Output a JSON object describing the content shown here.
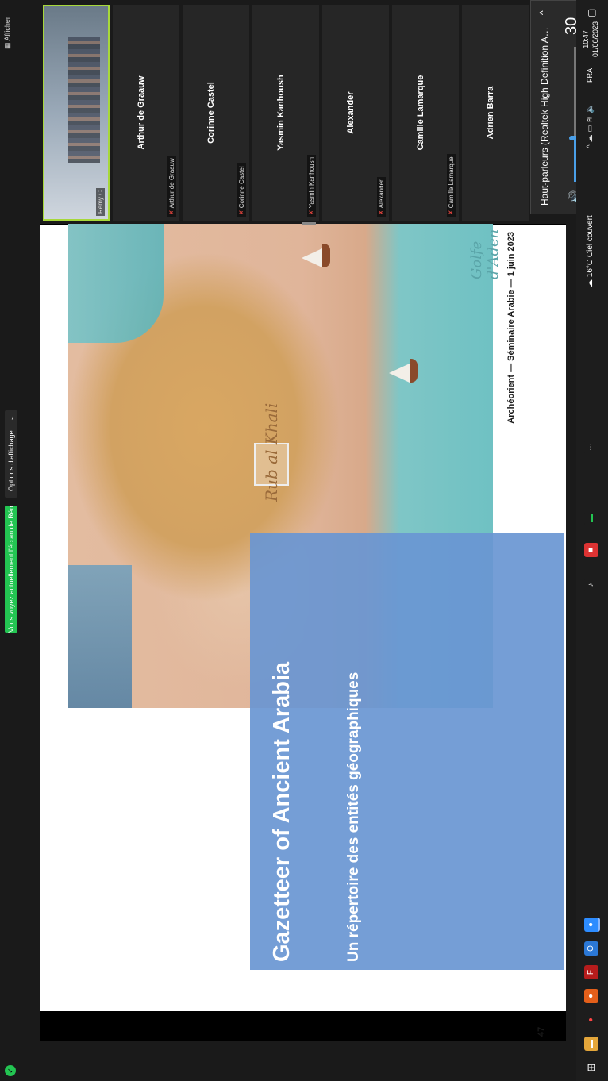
{
  "topbar": {
    "notice": "Vous voyez actuellement l'écran de Rémy C",
    "options_label": "Options d'affichage",
    "afficher_label": "Afficher"
  },
  "slide": {
    "title": "Gazetteer of Ancient Arabia",
    "subtitle": "Un répertoire des entités géographiques",
    "footer": "Archéorient — Séminaire Arabie — 1 juin 2023",
    "page_number": "47",
    "map_label_rub": "Rub al Khali",
    "map_label_aden": "Golfe d'Aden"
  },
  "participants": [
    {
      "name": "Rémy C",
      "label": "Rémy C",
      "video": true
    },
    {
      "name": "Arthur de Graauw",
      "label": "Arthur de Graauw"
    },
    {
      "name": "Corinne Castel",
      "label": "Corinne Castel"
    },
    {
      "name": "Yasmin Kanhoush",
      "label": "Yasmin Kanhoush"
    },
    {
      "name": "Alexander",
      "label": "Alexander"
    },
    {
      "name": "Camille Lamarque",
      "label": "Camille Lamarque"
    },
    {
      "name": "Adrien Barra",
      "label": ""
    }
  ],
  "speaker": {
    "device": "Haut-parleurs (Realtek High Definition Audio(...",
    "volume": 30
  },
  "tray": {
    "weather": "16°C Ciel couvert",
    "language": "FRA",
    "time": "10:47",
    "date": "01/06/2023"
  },
  "colors": {
    "accent_green": "#23c552",
    "slide_blue": "#6996d2",
    "active_border": "#a7d83a"
  }
}
